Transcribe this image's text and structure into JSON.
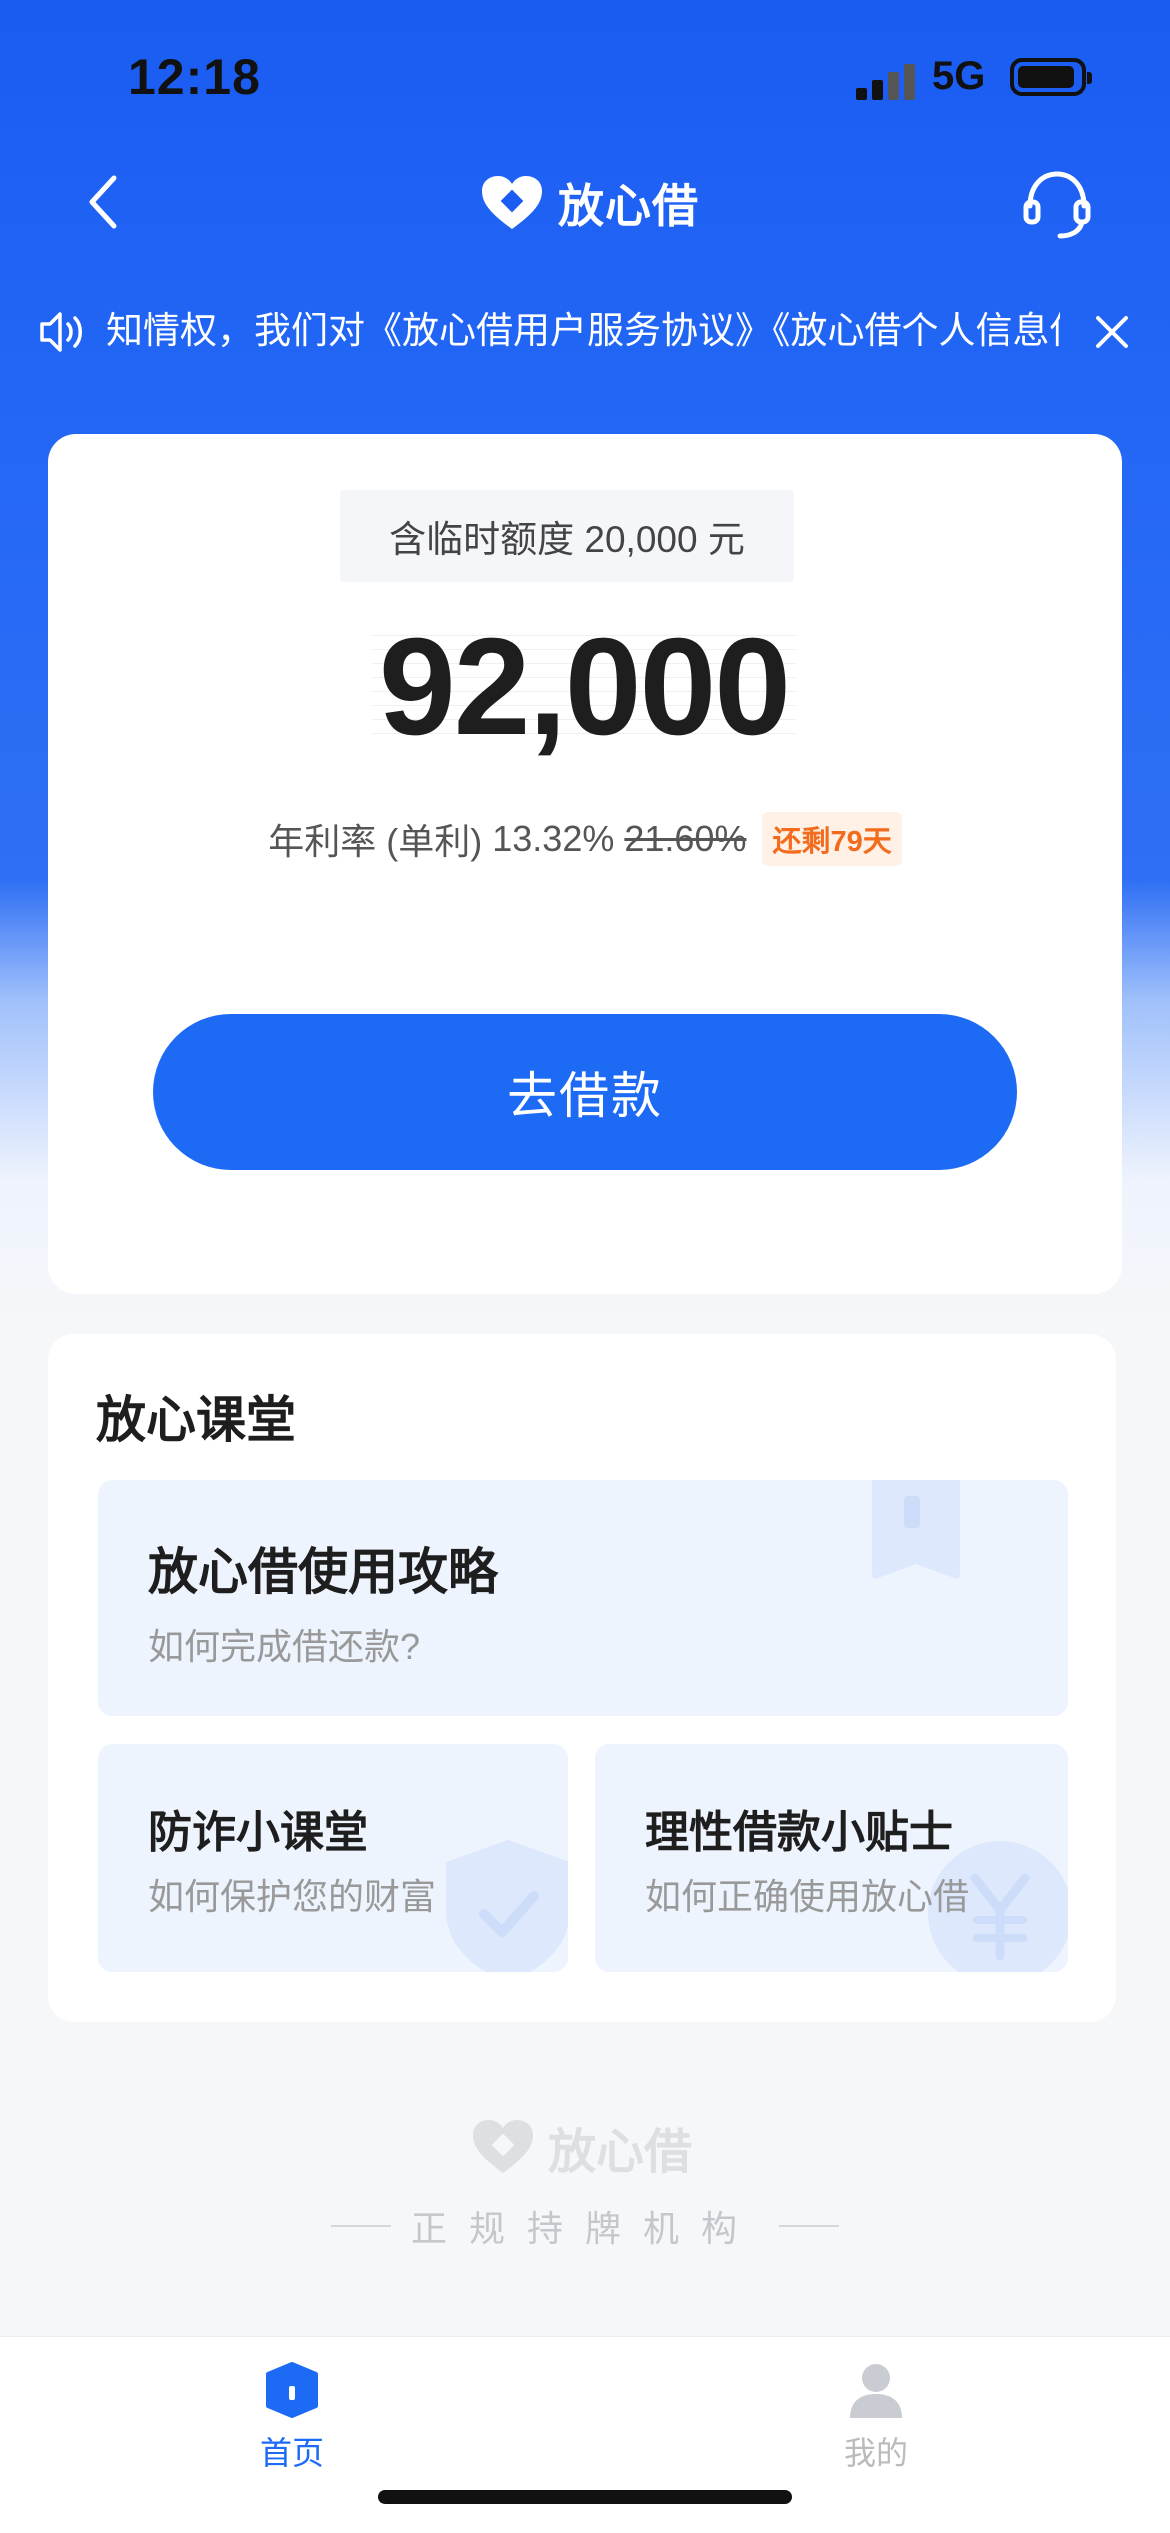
{
  "status_bar": {
    "time": "12:18",
    "network": "5G"
  },
  "nav": {
    "title": "放心借"
  },
  "notice": {
    "text": "知情权，我们对《放心借用户服务协议》《放心借个人信息保护政策》进行了更新"
  },
  "quota": {
    "temporary_label": "含临时额度 20,000 元",
    "amount": "92,000",
    "rate_label": "年利率 (单利)",
    "rate_value": "13.32%",
    "rate_original": "21.60%",
    "rate_badge": "还剩79天",
    "cta_label": "去借款"
  },
  "classroom": {
    "title": "放心课堂",
    "items": [
      {
        "title": "放心借使用攻略",
        "subtitle": "如何完成借还款?"
      },
      {
        "title": "防诈小课堂",
        "subtitle": "如何保护您的财富"
      },
      {
        "title": "理性借款小贴士",
        "subtitle": "如何正确使用放心借"
      }
    ]
  },
  "footer": {
    "brand": "放心借",
    "slogan": "正规持牌机构"
  },
  "tabbar": {
    "items": [
      {
        "label": "首页",
        "active": true
      },
      {
        "label": "我的",
        "active": false
      }
    ]
  },
  "colors": {
    "primary": "#1d6af5",
    "header_bg": "#1a5cf2",
    "badge_text": "#f36b1c",
    "badge_bg": "#fff1e6"
  }
}
